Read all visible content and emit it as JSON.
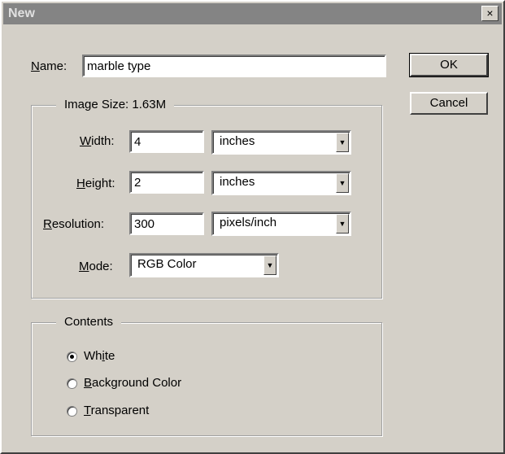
{
  "window": {
    "title": "New",
    "close_glyph": "×"
  },
  "name_field": {
    "label_key": "N",
    "label_rest": "ame:",
    "value": "marble type"
  },
  "buttons": {
    "ok": "OK",
    "cancel": "Cancel"
  },
  "image_size": {
    "legend": "Image Size: 1.63M",
    "width": {
      "label_key": "W",
      "label_rest": "idth:",
      "value": "4",
      "unit": "inches"
    },
    "height": {
      "label_key": "H",
      "label_rest": "eight:",
      "value": "2",
      "unit": "inches"
    },
    "resolution": {
      "label_key": "R",
      "label_rest": "esolution:",
      "value": "300",
      "unit": "pixels/inch"
    },
    "mode": {
      "label_key": "M",
      "label_rest": "ode:",
      "value": "RGB Color"
    }
  },
  "contents": {
    "legend": "Contents",
    "options": [
      {
        "pre": "Wh",
        "key": "i",
        "post": "te",
        "selected": true
      },
      {
        "pre": "",
        "key": "B",
        "post": "ackground Color",
        "selected": false
      },
      {
        "pre": "",
        "key": "T",
        "post": "ransparent",
        "selected": false
      }
    ]
  },
  "icons": {
    "dropdown": "chevron-down-icon",
    "close": "close-icon"
  }
}
